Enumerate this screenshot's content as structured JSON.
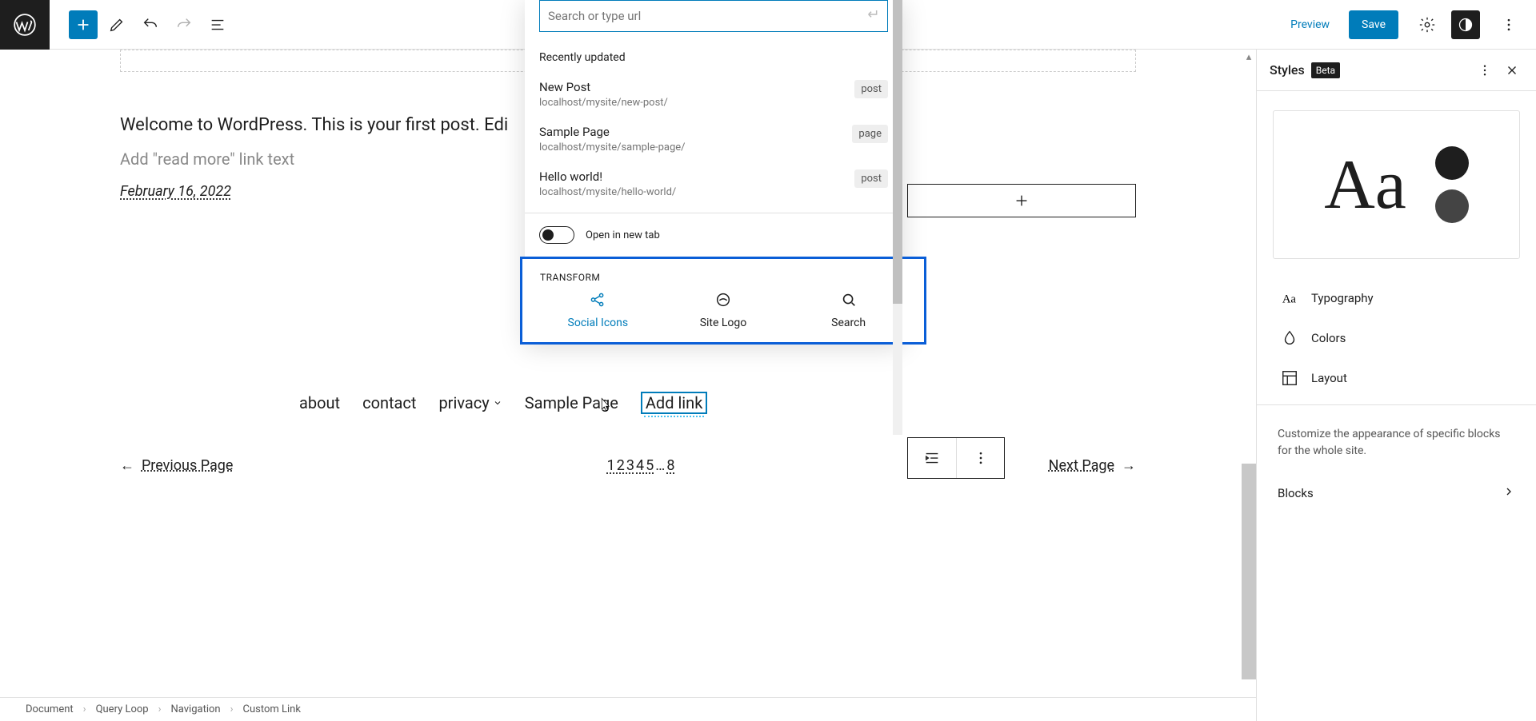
{
  "toolbar": {
    "preview": "Preview",
    "save": "Save"
  },
  "canvas": {
    "post_excerpt": "Welcome to WordPress. This is your first post. Edi",
    "readmore_placeholder": "Add \"read more\" link text",
    "date": "February 16, 2022",
    "nav": {
      "items": [
        "about",
        "contact",
        "privacy",
        "Sample Page"
      ],
      "add_link": "Add link"
    },
    "pagination": {
      "prev": "Previous Page",
      "next": "Next Page",
      "numbers": [
        "1",
        "2",
        "3",
        "4",
        "5",
        "…",
        "8"
      ]
    }
  },
  "popover": {
    "search_placeholder": "Search or type url",
    "recently_label": "Recently updated",
    "items": [
      {
        "title": "New Post",
        "url": "localhost/mysite/new-post/",
        "type": "post"
      },
      {
        "title": "Sample Page",
        "url": "localhost/mysite/sample-page/",
        "type": "page"
      },
      {
        "title": "Hello world!",
        "url": "localhost/mysite/hello-world/",
        "type": "post"
      }
    ],
    "open_new_tab": "Open in new tab",
    "transform_label": "TRANSFORM",
    "transform_items": [
      {
        "label": "Social Icons"
      },
      {
        "label": "Site Logo"
      },
      {
        "label": "Search"
      }
    ]
  },
  "sidebar": {
    "title": "Styles",
    "beta": "Beta",
    "preview_text": "Aa",
    "options": {
      "typography": "Typography",
      "colors": "Colors",
      "layout": "Layout"
    },
    "desc": "Customize the appearance of specific blocks for the whole site.",
    "blocks": "Blocks"
  },
  "breadcrumb": [
    "Document",
    "Query Loop",
    "Navigation",
    "Custom Link"
  ]
}
